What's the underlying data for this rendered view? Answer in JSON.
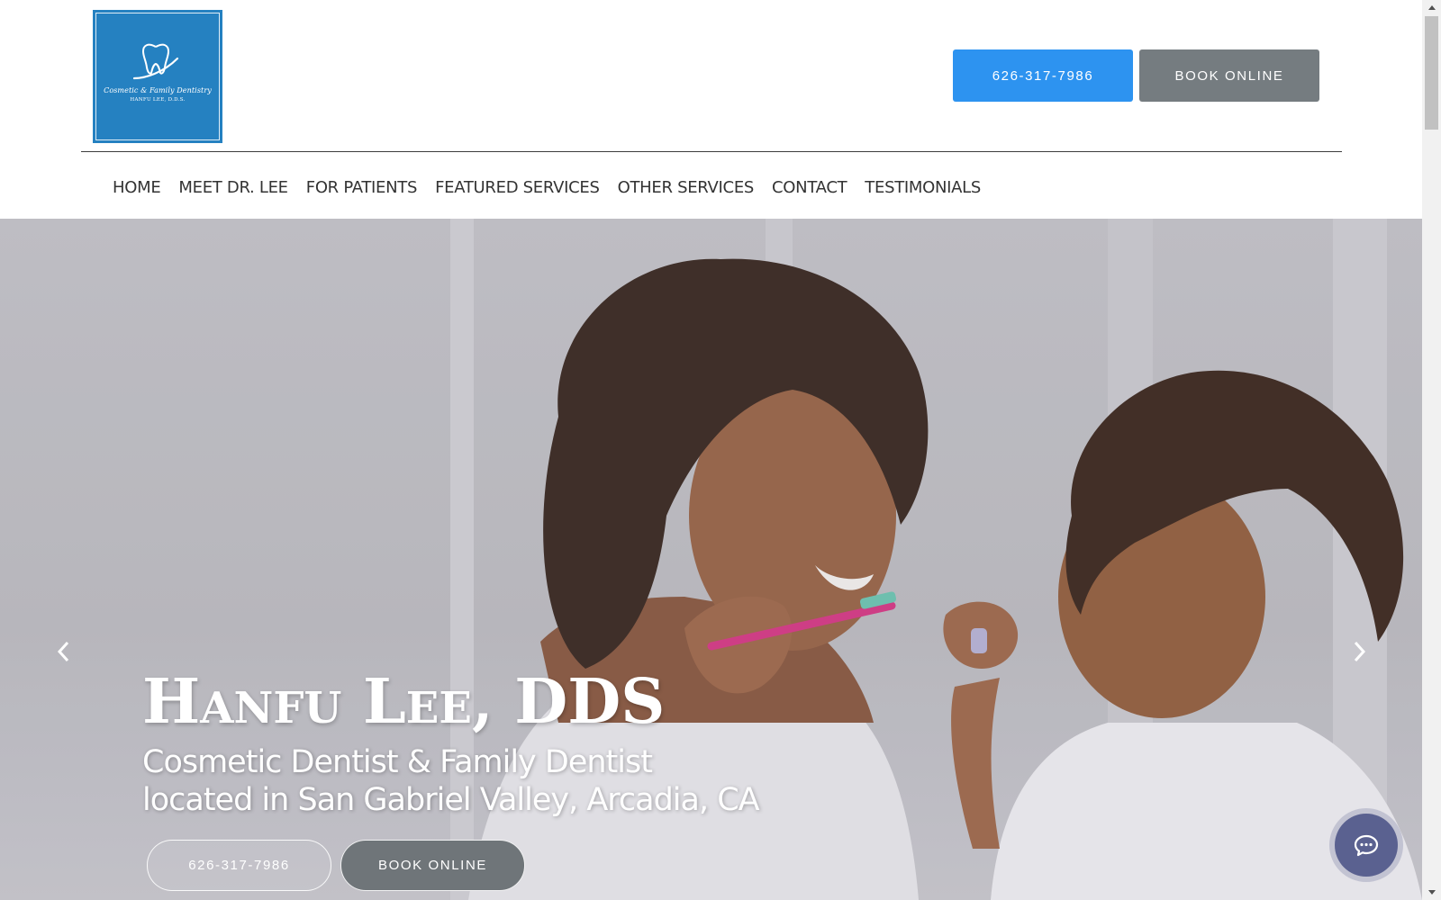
{
  "logo": {
    "icon": "tooth-icon",
    "name": "Cosmetic & Family Dentistry",
    "subtitle": "HANFU LEE, D.D.S."
  },
  "header": {
    "phone_label": "626-317-7986",
    "book_label": "BOOK ONLINE",
    "phone_color": "#2d93f0",
    "book_color": "#757c80"
  },
  "nav": {
    "items": [
      {
        "label": "HOME"
      },
      {
        "label": "MEET DR. LEE"
      },
      {
        "label": "FOR PATIENTS"
      },
      {
        "label": "FEATURED SERVICES"
      },
      {
        "label": "OTHER SERVICES"
      },
      {
        "label": "CONTACT"
      },
      {
        "label": "TESTIMONIALS"
      }
    ]
  },
  "hero": {
    "title": "Hanfu Lee, DDS",
    "subtitle_line1": "Cosmetic Dentist & Family Dentist",
    "subtitle_line2": "located in San Gabriel Valley, Arcadia, CA",
    "phone_label": "626-317-7986",
    "book_label": "BOOK ONLINE",
    "prev_icon": "chevron-left-icon",
    "next_icon": "chevron-right-icon"
  },
  "chat": {
    "icon": "chat-bubble-icon",
    "color": "#5a6190"
  }
}
